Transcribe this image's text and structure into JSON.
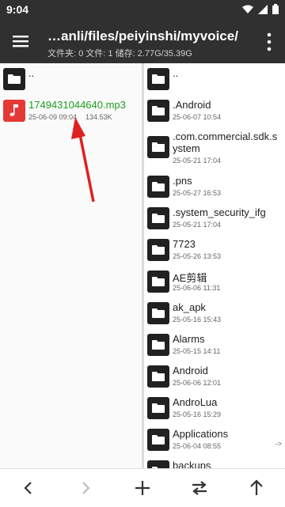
{
  "status": {
    "time": "9:04"
  },
  "header": {
    "path": "…anli/files/peiyinshi/myvoice/",
    "subinfo": "文件夹: 0  文件: 1  储存: 2.77G/35.39G"
  },
  "left_pane": {
    "parent": "..",
    "files": [
      {
        "name": "1749431044640.mp3",
        "date": "25-06-09 09:04",
        "size": "134.53K"
      }
    ]
  },
  "right_pane": {
    "parent": "..",
    "folders": [
      {
        "name": ".Android",
        "date": "25-06-07 10:54"
      },
      {
        "name": ".com.commercial.sdk.system",
        "date": "25-05-21 17:04"
      },
      {
        "name": ".pns",
        "date": "25-05-27 16:53"
      },
      {
        "name": ".system_security_ifg",
        "date": "25-05-21 17:04"
      },
      {
        "name": "7723",
        "date": "25-05-26 13:53"
      },
      {
        "name": "AE剪辑",
        "date": "25-06-06 11:31"
      },
      {
        "name": "ak_apk",
        "date": "25-05-16 15:43"
      },
      {
        "name": "Alarms",
        "date": "25-05-15 14:11"
      },
      {
        "name": "Android",
        "date": "25-06-06 12:01"
      },
      {
        "name": "AndroLua",
        "date": "25-05-16 15:29"
      },
      {
        "name": "Applications",
        "date": "25-06-04 08:55",
        "arrow": "->"
      },
      {
        "name": "backups",
        "date": ""
      }
    ]
  },
  "bottom_bar": {
    "buttons": [
      "back",
      "forward",
      "add",
      "swap",
      "up"
    ]
  }
}
